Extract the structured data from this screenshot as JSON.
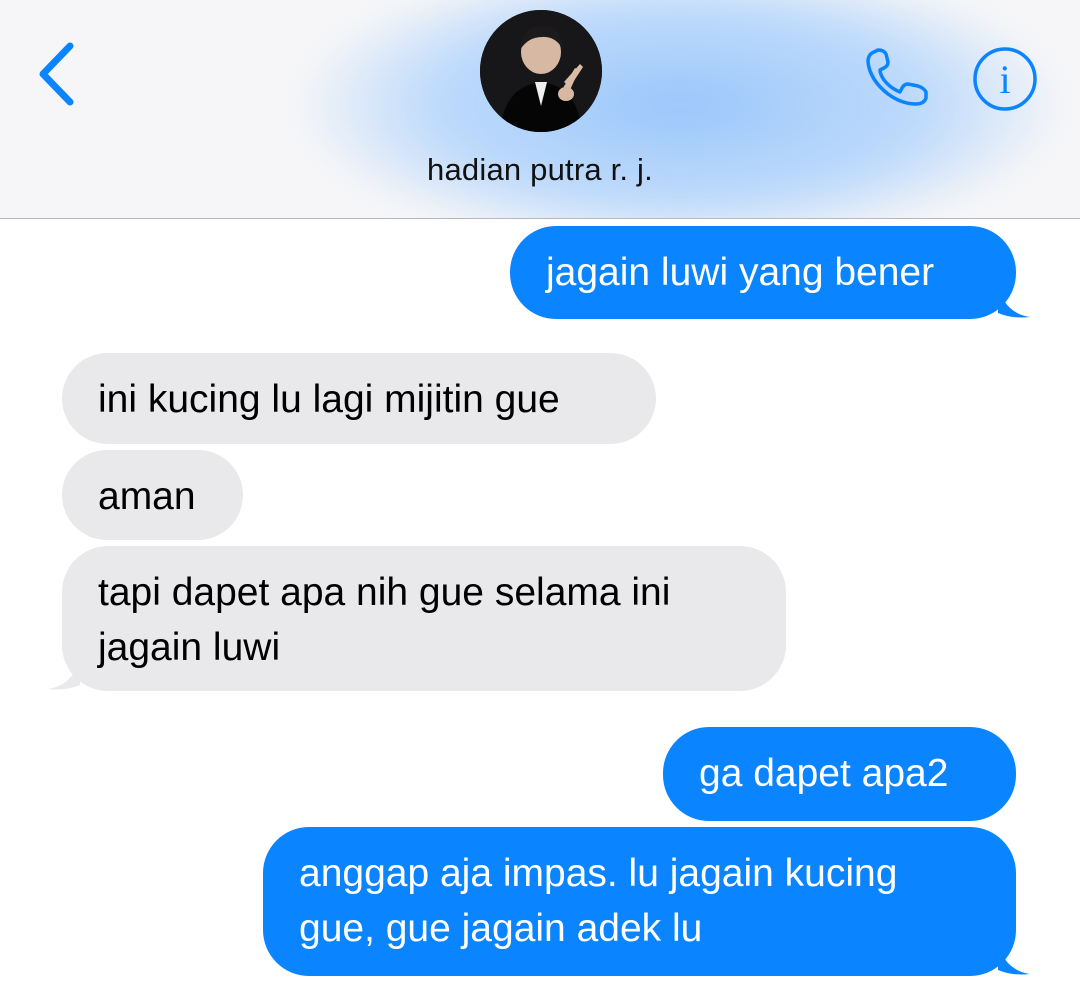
{
  "header": {
    "contact_name": "hadian putra r. j.",
    "avatar_description": "contact-photo",
    "back_icon": "chevron-left-icon",
    "call_icon": "phone-icon",
    "info_icon": "info-icon",
    "info_glyph": "i",
    "accent_color": "#0a84ff"
  },
  "colors": {
    "sent_bubble": "#0a84ff",
    "received_bubble": "#e9e9eb",
    "sent_text": "#ffffff",
    "received_text": "#000000"
  },
  "messages": [
    {
      "direction": "sent",
      "text": "jagain luwi yang bener"
    },
    {
      "direction": "received",
      "text": "ini kucing lu lagi mijitin gue"
    },
    {
      "direction": "received",
      "text": "aman"
    },
    {
      "direction": "received",
      "text": "tapi dapet apa nih gue selama ini\njagain luwi"
    },
    {
      "direction": "sent",
      "text": "ga dapet apa2"
    },
    {
      "direction": "sent",
      "text": "anggap aja impas. lu jagain kucing\ngue, gue jagain adek lu"
    }
  ]
}
